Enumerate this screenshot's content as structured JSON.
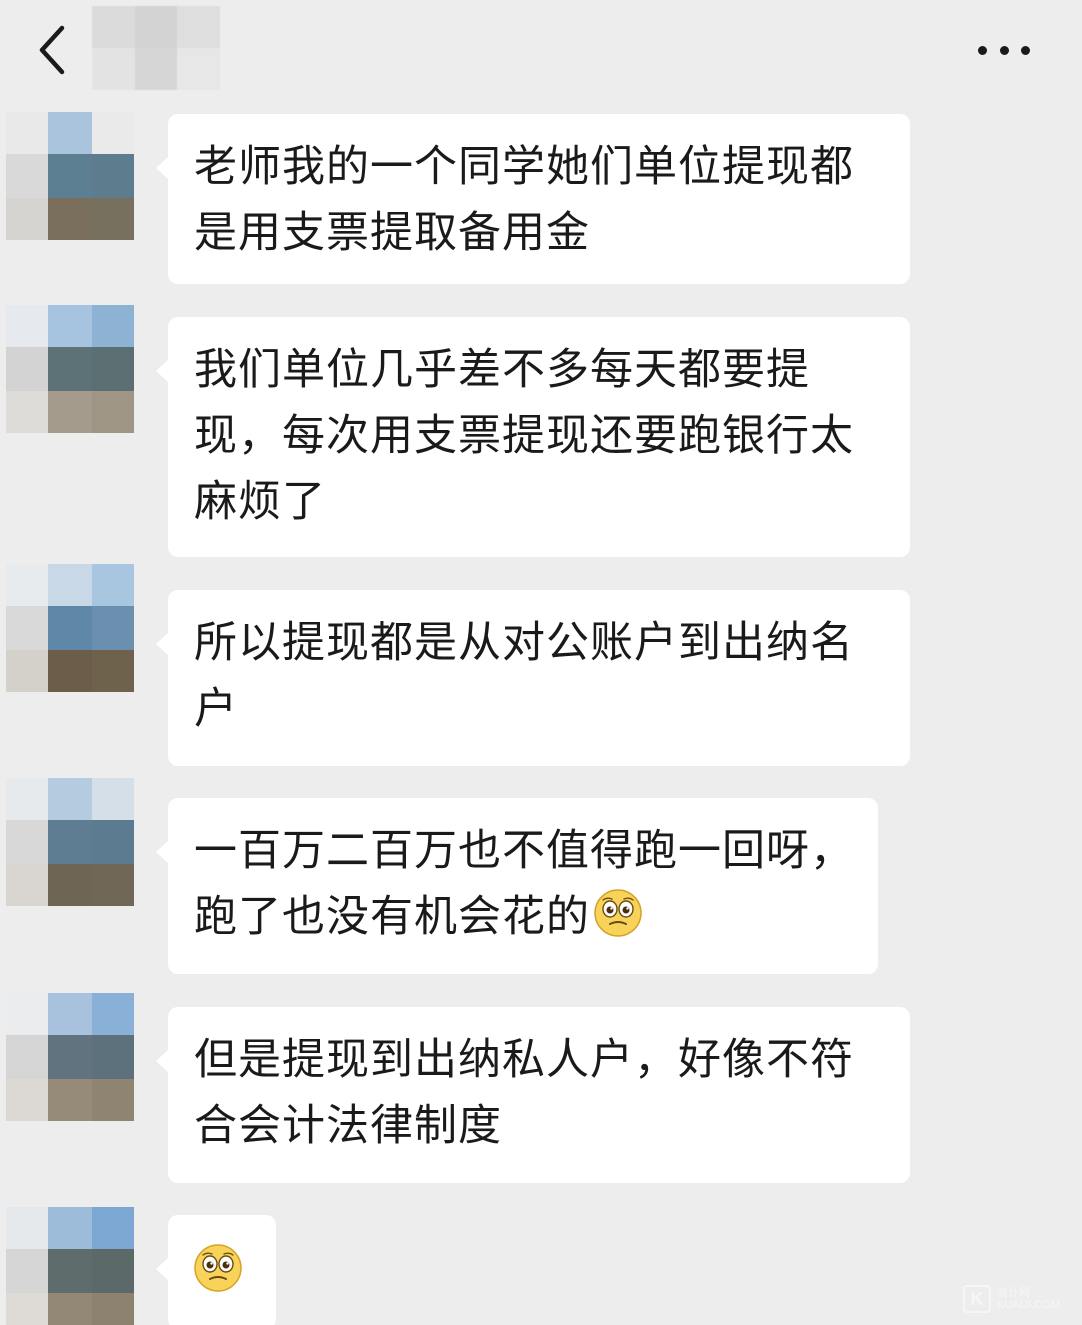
{
  "header": {
    "back_icon": "chevron-left-icon",
    "title": "",
    "more_icon": "more-dots-icon"
  },
  "messages": [
    {
      "text": "老师我的一个同学她们单位提现都是用支票提取备用金",
      "emoji": ""
    },
    {
      "text": "我们单位几乎差不多每天都要提现，每次用支票提现还要跑银行太麻烦了",
      "emoji": ""
    },
    {
      "text": "所以提现都是从对公账户到出纳名户",
      "emoji": ""
    },
    {
      "text": "一百万二百万也不值得跑一回呀，跑了也没有机会花的",
      "emoji": "pleading-face-icon"
    },
    {
      "text": "但是提现到出纳私人户，好像不符合会计法律制度",
      "emoji": ""
    },
    {
      "text": "",
      "emoji": "pleading-face-icon"
    }
  ],
  "watermark": {
    "logo_letter": "K",
    "line1": "会计网",
    "line2": "KUAIJI.COM"
  },
  "colors": {
    "background": "#ededed",
    "bubble": "#ffffff",
    "text": "#1a1a1a"
  }
}
